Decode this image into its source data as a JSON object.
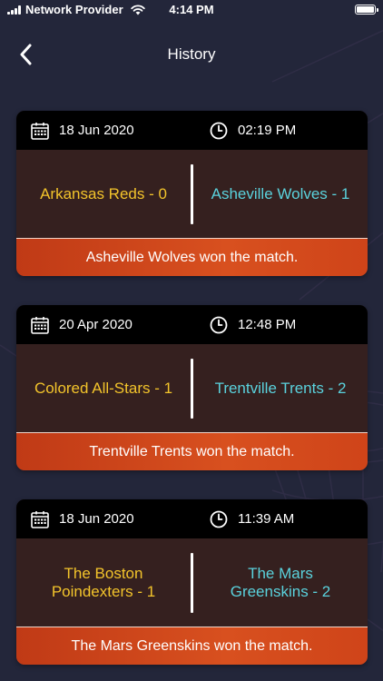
{
  "status_bar": {
    "carrier": "Network Provider",
    "time": "4:14 PM"
  },
  "nav": {
    "title": "History"
  },
  "icons": {
    "back": "chevron-left-icon",
    "date": "calendar-icon",
    "time": "clock-icon"
  },
  "colors": {
    "background": "#23263a",
    "card_body": "#35201f",
    "card_header": "#000000",
    "result_bar": "#d24a1c",
    "home_team_text": "#f3c42b",
    "away_team_text": "#5ad2dd"
  },
  "matches": [
    {
      "date": "18 Jun 2020",
      "time": "02:19 PM",
      "home": "Arkansas Reds - 0",
      "away": "Asheville Wolves - 1",
      "result": "Asheville Wolves won the match."
    },
    {
      "date": "20 Apr 2020",
      "time": "12:48 PM",
      "home": "Colored All-Stars - 1",
      "away": "Trentville Trents - 2",
      "result": "Trentville Trents won the match."
    },
    {
      "date": "18 Jun 2020",
      "time": "11:39 AM",
      "home": "The Boston Poindexters - 1",
      "away": "The Mars Greenskins - 2",
      "result": "The Mars Greenskins won the match."
    }
  ]
}
